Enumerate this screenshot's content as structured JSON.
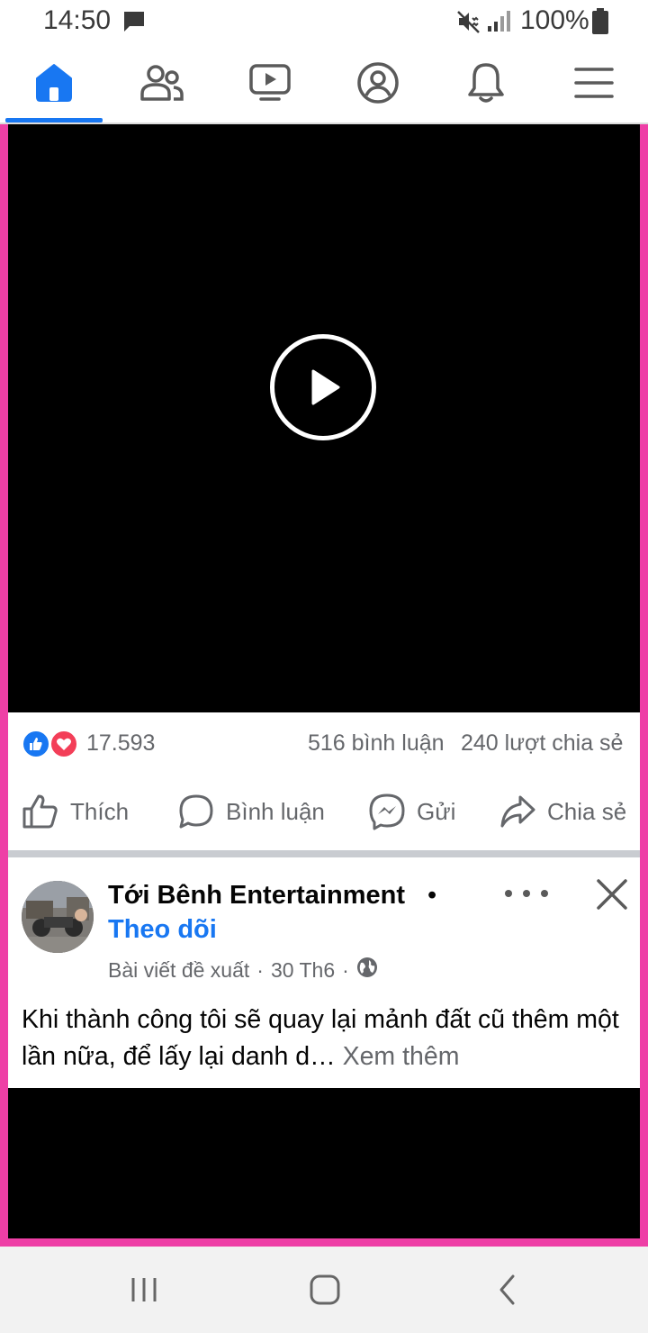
{
  "status_bar": {
    "time": "14:50",
    "battery": "100%",
    "icons": [
      "message-icon",
      "mute-icon",
      "signal-icon",
      "battery-icon"
    ]
  },
  "tabs": [
    {
      "name": "home",
      "icon": "home-icon",
      "active": true
    },
    {
      "name": "friends",
      "icon": "friends-icon",
      "active": false
    },
    {
      "name": "watch",
      "icon": "video-icon",
      "active": false
    },
    {
      "name": "profile",
      "icon": "profile-icon",
      "active": false
    },
    {
      "name": "notifications",
      "icon": "bell-icon",
      "active": false
    },
    {
      "name": "menu",
      "icon": "menu-icon",
      "active": false
    }
  ],
  "post1": {
    "reactions_count": "17.593",
    "comments_count": "516 bình luận",
    "shares_count": "240 lượt chia sẻ",
    "actions": {
      "like": "Thích",
      "comment": "Bình luận",
      "send": "Gửi",
      "share": "Chia sẻ"
    }
  },
  "post2": {
    "author": "Tới Bênh Entertainment",
    "separator": "•",
    "follow": "Theo dõi",
    "meta_label": "Bài viết đề xuất",
    "meta_sep": "·",
    "meta_date": "30 Th6",
    "meta_sep2": "·",
    "text": "Khi thành công tôi sẽ quay lại mảnh đất cũ thêm một lần nữa, để lấy lại danh d…",
    "see_more": "Xem thêm"
  },
  "colors": {
    "accent": "#1877f2",
    "frame": "#ee3fa6",
    "love": "#f33e58",
    "secondary_text": "#65676b"
  }
}
